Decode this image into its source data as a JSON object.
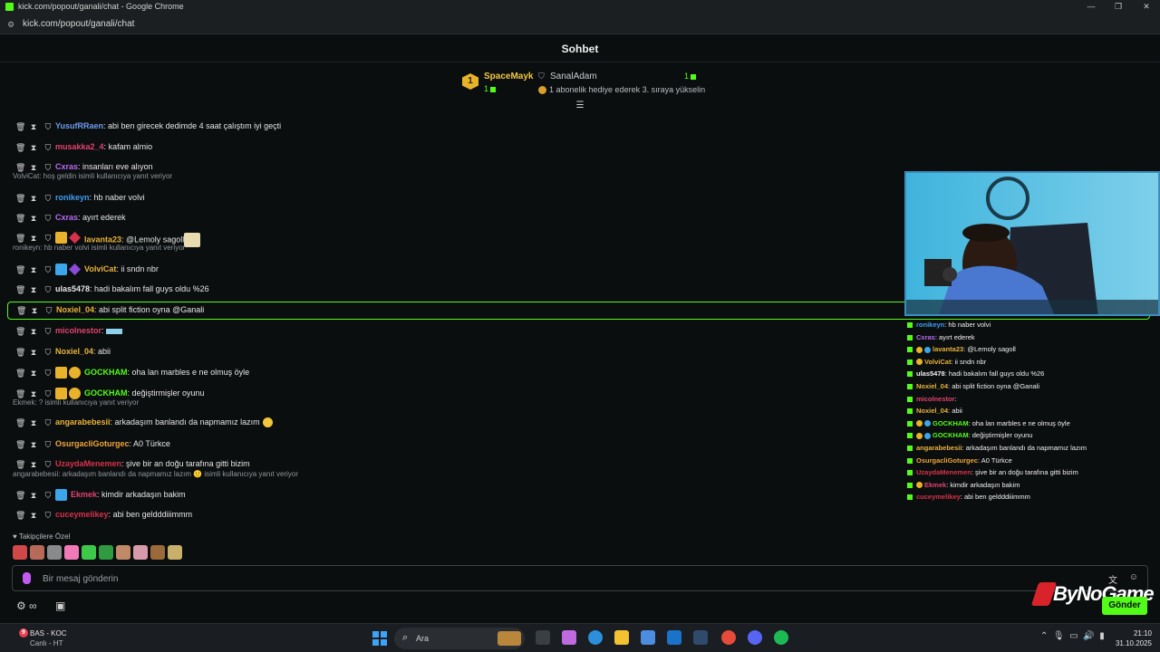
{
  "window": {
    "title": "kick.com/popout/ganali/chat - Google Chrome",
    "min": "—",
    "max": "❐",
    "close": "✕"
  },
  "address_bar": {
    "url": "kick.com/popout/ganali/chat"
  },
  "chat": {
    "title": "Sohbet"
  },
  "leaderboard": {
    "first": {
      "rank": "1",
      "name": "SpaceMayk",
      "count": "1"
    },
    "second": {
      "name": "SanalAdam",
      "count": "1",
      "promo": "1 abonelik hediye ederek 3. sıraya yükselin"
    }
  },
  "messages": [
    {
      "user": "YusufRRaen",
      "color": "#6d9bef",
      "text": "abi ben girecek dedimde 4 saat çalıştım iyi geçti"
    },
    {
      "user": "musakka2_4",
      "color": "#e0426e",
      "text": "kafam almio"
    },
    {
      "user": "Cxras",
      "color": "#b76af2",
      "text": "insanları eve alıyon"
    },
    {
      "reply": "VolviCat: hoş geldin isimli kullanıcıya yanıt veriyor"
    },
    {
      "user": "ronikeyn",
      "color": "#3e9df2",
      "text": "hb naber volvi"
    },
    {
      "user": "Cxras",
      "color": "#b76af2",
      "text": "ayırt ederek"
    },
    {
      "user": "lavanta23",
      "color": "#e8b23a",
      "text": "@Lemoly sagoll"
    },
    {
      "reply": "ronikeyn: hb naber volvi isimli kullanıcıya yanıt veriyor"
    },
    {
      "user": "VolviCat",
      "color": "#e8b23a",
      "text": "ii sndn nbr"
    },
    {
      "user": "ulas5478",
      "color": "#e6e6e6",
      "text": "hadi bakalım fall guys oldu %26"
    },
    {
      "user": "Noxiel_04",
      "color": "#e8b23a",
      "text": "abi split fiction oyna @Ganali"
    },
    {
      "user": "micolnestor",
      "color": "#e0426e",
      "text": ""
    },
    {
      "user": "Noxiel_04",
      "color": "#e8b23a",
      "text": "abii"
    },
    {
      "user": "GOCKHAM",
      "color": "#53fc18",
      "text": "oha lan marbles e ne olmuş öyle"
    },
    {
      "user": "GOCKHAM",
      "color": "#53fc18",
      "text": "değiştirmişler oyunu"
    },
    {
      "reply": "Ekmek: ? isimli kullanıcıya yanıt veriyor"
    },
    {
      "user": "angarabebesii",
      "color": "#e8b23a",
      "text": "arkadaşım banlandı da napmamız lazım"
    },
    {
      "user": "OsurgacliGoturgec",
      "color": "#f0a53a",
      "text": "A0 Türkce"
    },
    {
      "user": "UzaydaMenemen",
      "color": "#d8314a",
      "text": "şive bir an doğu tarafına gitti bizim"
    },
    {
      "reply": "angarabebesii: arkadaşım banlandı da napmamız lazım 🙂 isimli kullanıcıya yanıt veriyor"
    },
    {
      "user": "Ekmek",
      "color": "#e0426e",
      "text": "kimdir arkadaşın bakim"
    },
    {
      "user": "cuceymelikey",
      "color": "#d8314a",
      "text": "abi ben geldddiiimmm"
    }
  ],
  "followers_only": "Takipçilere Özel",
  "input": {
    "placeholder": "Bir mesaj gönderin"
  },
  "send_label": "Gönder",
  "watermark": "ByNoGame",
  "overlay": [
    {
      "user": "ronikeyn",
      "color": "#3e9df2",
      "text": ": hb naber volvi"
    },
    {
      "user": "Cxras",
      "color": "#b76af2",
      "text": ": ayırt ederek"
    },
    {
      "user": "lavanta23",
      "color": "#e8b23a",
      "text": ": @Lemoly sagoll"
    },
    {
      "user": "VolviCat",
      "color": "#e8b23a",
      "text": ": ii sndn nbr"
    },
    {
      "user": "ulas5478",
      "color": "#f0f0f0",
      "text": ": hadi bakalım fall guys oldu %26"
    },
    {
      "user": "Noxiel_04",
      "color": "#e8b23a",
      "text": ": abi split fiction oyna @Ganali"
    },
    {
      "user": "micolnestor",
      "color": "#e0426e",
      "text": ":"
    },
    {
      "user": "Noxiel_04",
      "color": "#e8b23a",
      "text": ": abii"
    },
    {
      "user": "GOCKHAM",
      "color": "#53fc18",
      "text": ": oha lan marbles e ne olmuş öyle"
    },
    {
      "user": "GOCKHAM",
      "color": "#53fc18",
      "text": ": değiştirmişler oyunu"
    },
    {
      "user": "angarabebesii",
      "color": "#e8b23a",
      "text": ": arkadaşım banlandı da napmamız lazım"
    },
    {
      "user": "OsurgacliGoturgec",
      "color": "#f0a53a",
      "text": ": A0 Türkce"
    },
    {
      "user": "UzaydaMenemen",
      "color": "#d8314a",
      "text": ": şive bir an doğu tarafına gitti bizim"
    },
    {
      "user": "Ekmek",
      "color": "#e0426e",
      "text": ": kimdir arkadaşın bakim"
    },
    {
      "user": "cuceymelikey",
      "color": "#d8314a",
      "text": ": abi ben geldddiiimmm"
    }
  ],
  "taskbar": {
    "news_badge": "9",
    "news_line1": "BAS - KOC",
    "news_line2": "Canlı - HT",
    "search_label": "Ara",
    "time": "21:10",
    "date": "31.10.2025"
  },
  "colors": {
    "accent": "#53fc18",
    "background": "#0b0e0f"
  }
}
